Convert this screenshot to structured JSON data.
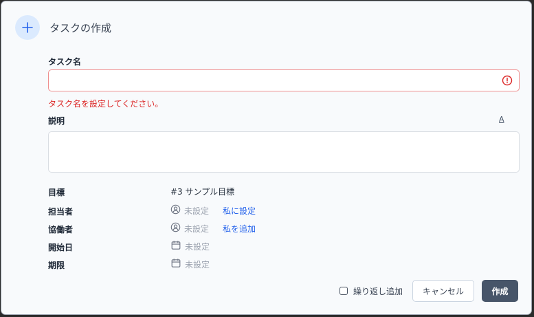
{
  "dialog": {
    "title": "タスクの作成",
    "icon": "plus-icon"
  },
  "task_name": {
    "label": "タスク名",
    "value": "",
    "error": "タスク名を設定してください。"
  },
  "description": {
    "label": "説明",
    "format_button": "A",
    "value": ""
  },
  "fields": {
    "goal": {
      "label": "目標",
      "value": "#3 サンプル目標"
    },
    "assignee": {
      "label": "担当者",
      "value": "未設定",
      "action": "私に設定"
    },
    "collaborators": {
      "label": "協働者",
      "value": "未設定",
      "action": "私を追加"
    },
    "start_date": {
      "label": "開始日",
      "value": "未設定"
    },
    "due_date": {
      "label": "期限",
      "value": "未設定"
    }
  },
  "footer": {
    "repeat_label": "繰り返し追加",
    "repeat_checked": false,
    "cancel_label": "キャンセル",
    "create_label": "作成"
  },
  "colors": {
    "accent": "#2563eb",
    "error": "#dc2626",
    "primary_button": "#475569"
  }
}
